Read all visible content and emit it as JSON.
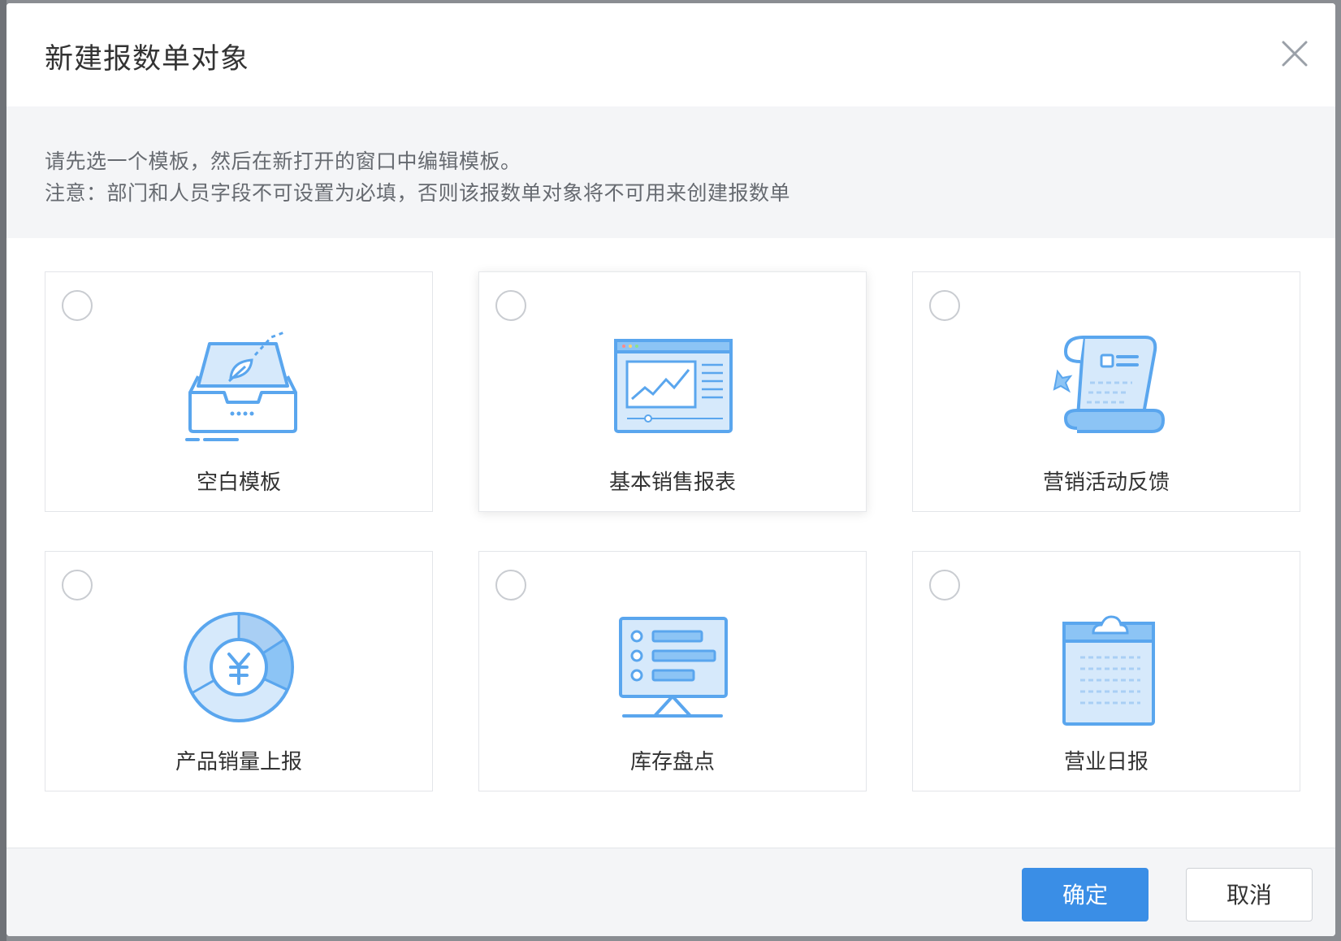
{
  "dialog": {
    "title": "新建报数单对象",
    "notice_line1": "请先选一个模板，然后在新打开的窗口中编辑模板。",
    "notice_line2": "注意：部门和人员字段不可设置为必填，否则该报数单对象将不可用来创建报数单"
  },
  "templates": [
    {
      "label": "空白模板",
      "icon": "blank-inbox-icon",
      "checked": false
    },
    {
      "label": "基本销售报表",
      "icon": "sales-chart-icon",
      "checked": false
    },
    {
      "label": "营销活动反馈",
      "icon": "scroll-icon",
      "checked": false
    },
    {
      "label": "产品销量上报",
      "icon": "yuan-donut-icon",
      "checked": false
    },
    {
      "label": "库存盘点",
      "icon": "presentation-board-icon",
      "checked": false
    },
    {
      "label": "营业日报",
      "icon": "clipboard-icon",
      "checked": false
    }
  ],
  "footer": {
    "confirm_label": "确定",
    "cancel_label": "取消"
  },
  "colors": {
    "primary": "#3a8ee6",
    "icon_light": "#d6e9fb",
    "icon_stroke": "#5aa6ee"
  }
}
